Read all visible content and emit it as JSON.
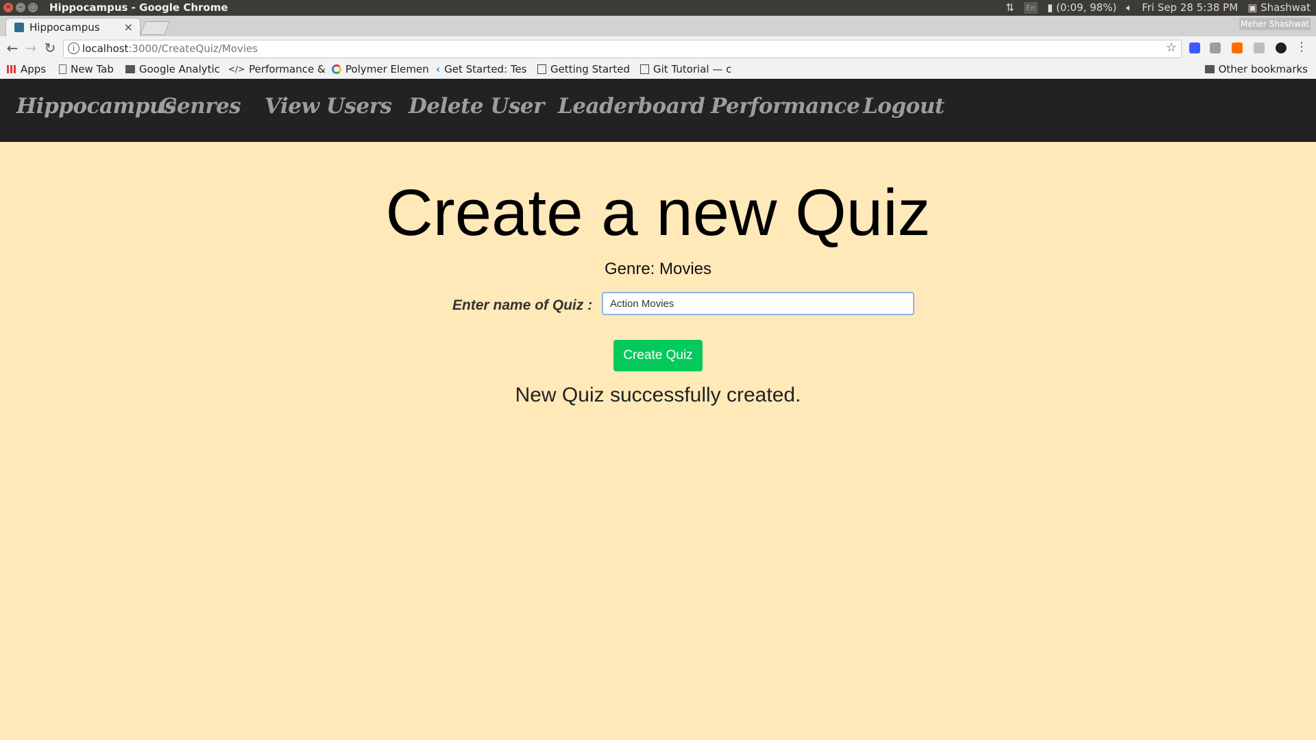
{
  "os": {
    "window_title": "Hippocampus - Google Chrome",
    "keyboard": "En",
    "battery": "(0:09, 98%)",
    "datetime": "Fri Sep 28  5:38 PM",
    "user": "Shashwat"
  },
  "browser": {
    "tab_title": "Hippocampus",
    "profile_name": "Meher Shashwat",
    "url_host": "localhost",
    "url_rest": ":3000/CreateQuiz/Movies",
    "bookmarks": {
      "apps": "Apps",
      "new_tab": "New Tab",
      "google_analytics": "Google Analytic",
      "performance": "Performance &",
      "polymer": "Polymer Elemen",
      "get_started": "Get Started: Tes",
      "getting_started": "Getting Started",
      "git_tutorial": "Git Tutorial — c",
      "other": "Other bookmarks"
    }
  },
  "navbar": {
    "brand": "Hippocampus",
    "genres": "Genres",
    "view_users": "View Users",
    "delete_user": "Delete User",
    "leaderboard": "Leaderboard",
    "performance": "Performance",
    "logout": "Logout"
  },
  "main": {
    "title": "Create a new Quiz",
    "genre_line": "Genre: Movies",
    "quiz_label": "Enter name of Quiz :",
    "quiz_value": "Action Movies",
    "create_button": "Create Quiz",
    "success_message": "New Quiz successfully created."
  },
  "colors": {
    "page_background": "#ffe9b9",
    "navbar_background": "#222222",
    "button_green": "#06c95c"
  }
}
